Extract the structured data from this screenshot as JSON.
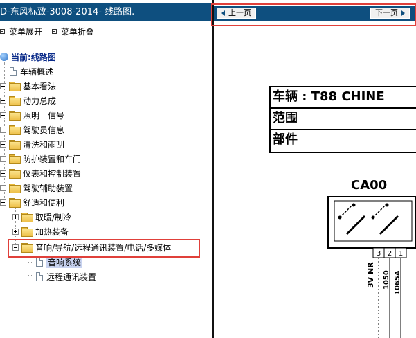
{
  "left_panel": {
    "title": "D-东风标致-3008-2014- 线路图.",
    "menu": {
      "expand": "菜单展开",
      "collapse": "菜单折叠"
    },
    "root": "当前:线路图",
    "items": [
      "车辆概述",
      "基本看法",
      "动力总成",
      "照明—信号",
      "驾驶员信息",
      "清洗和雨刮",
      "防护装置和车门",
      "仪表和控制装置",
      "驾驶辅助装置",
      "舒适和便利"
    ],
    "subitems": [
      "取暖/制冷",
      "加热装备"
    ],
    "selected_folder": "音响/导航/远程通讯装置/电话/多媒体",
    "leaf_items": [
      "音响系统",
      "远程通讯装置"
    ]
  },
  "right_panel": {
    "nav": {
      "prev": "上一页",
      "next": "下一页"
    },
    "info": {
      "vehicle": "车辆 : T88 CHINE",
      "scope": "范围",
      "part": "部件"
    },
    "component": "CA00",
    "pins": [
      "3",
      "2",
      "1"
    ],
    "wire_labels": [
      "3V NR",
      "1050",
      "1065A"
    ]
  },
  "colors": {
    "titlebar": "#0e4f7f",
    "highlight_box": "#e0403a"
  }
}
